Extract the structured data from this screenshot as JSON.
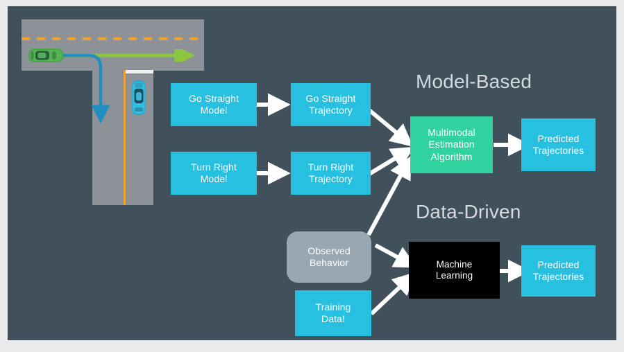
{
  "figure": {
    "background_color": "#41515c",
    "frame_color": "#e9eaec"
  },
  "scene": {
    "name": "intersection-scene",
    "road_color": "#8d9298",
    "lane_marking_color": "#f0a232",
    "stop_bar_color": "#eef0f2",
    "vehicles": [
      {
        "name": "green-car",
        "color": "#4aa84a",
        "heading": "east",
        "role": "target-vehicle"
      },
      {
        "name": "blue-car",
        "color": "#29b6d8",
        "heading": "north",
        "role": "other-vehicle"
      }
    ],
    "trajectories": [
      {
        "name": "go-straight-trajectory",
        "color": "#8cc63f",
        "label": "go straight"
      },
      {
        "name": "turn-right-trajectory",
        "color": "#1f8fc0",
        "label": "turn right"
      }
    ]
  },
  "sections": {
    "model_based": "Model-Based",
    "data_driven": "Data-Driven"
  },
  "nodes": {
    "go_straight_model": "Go Straight\nModel",
    "turn_right_model": "Turn Right\nModel",
    "go_straight_trajectory": "Go Straight\nTrajectory",
    "turn_right_trajectory": "Turn Right\nTrajectory",
    "multimodal_estimation": "Multimodal\nEstimation\nAlgorithm",
    "predicted_trajectories_model": "Predicted\nTrajectories",
    "observed_behavior": "Observed\nBehavior",
    "training_data": "Training\nData!",
    "machine_learning": "Machine\nLearning",
    "predicted_trajectories_data": "Predicted\nTrajectories"
  },
  "colors": {
    "cyan_box": "#27c0e0",
    "green_box": "#30d3a0",
    "black_box": "#000000",
    "gray_box": "#9aa6b2",
    "arrow": "#ffffff",
    "title_text": "#d6dade"
  }
}
